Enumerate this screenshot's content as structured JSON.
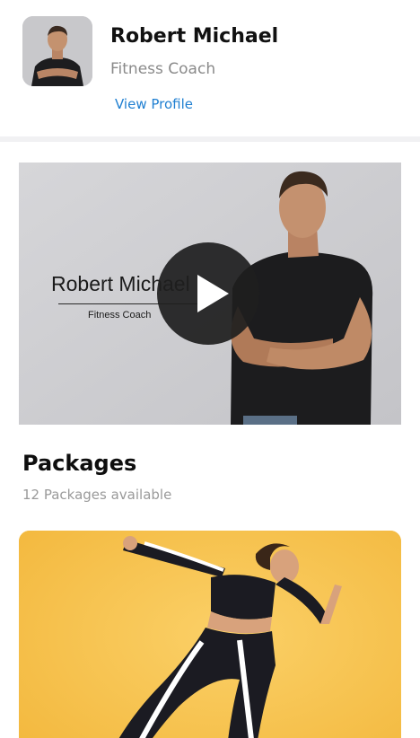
{
  "profile": {
    "name": "Robert Michael",
    "role": "Fitness Coach",
    "view_profile_label": "View Profile"
  },
  "video": {
    "title": "Robert Michael",
    "subtitle": "Fitness Coach",
    "play_icon": "play-icon"
  },
  "packages": {
    "title": "Packages",
    "subtitle": "12 Packages available"
  },
  "colors": {
    "link": "#1f7fd1",
    "card_bg": "#f6c04c",
    "video_bg": "#d0d0d3"
  }
}
